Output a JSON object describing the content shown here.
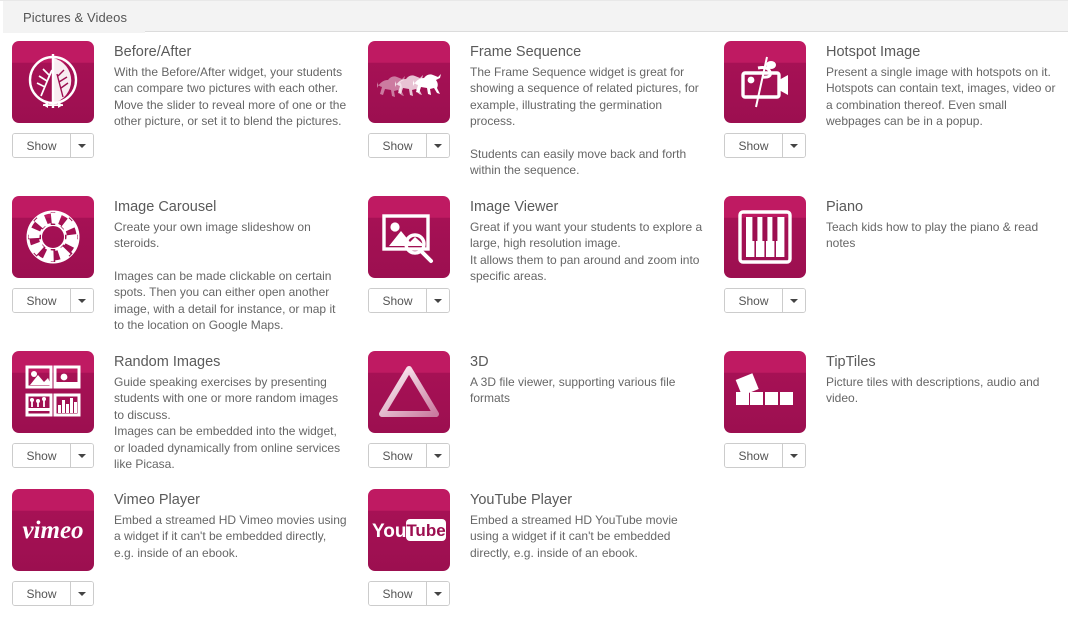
{
  "header": {
    "tab_label": "Pictures & Videos"
  },
  "button": {
    "show_label": "Show",
    "dropdown_icon": "chevron-down-icon"
  },
  "colors": {
    "tile_top": "#bf1a62",
    "tile_bottom": "#9c0f50",
    "tile_glyph": "#ffffff",
    "header_bg": "#f3f3f3",
    "title_text": "#5a5a5a",
    "body_text": "#666666",
    "button_border": "#cccccc"
  },
  "widgets": [
    {
      "title": "Before/After",
      "icon": "before-after-tree-circle-icon",
      "paragraphs": [
        "With the Before/After widget, your students can compare two pictures with each other. Move the slider to reveal more of one or the other picture, or set it to blend the pictures."
      ]
    },
    {
      "title": "Frame Sequence",
      "icon": "frame-sequence-horses-icon",
      "paragraphs": [
        "The Frame Sequence widget is great for showing a sequence of related pictures, for example, illustrating the germination process.",
        "Students can easily move back and forth within the sequence."
      ]
    },
    {
      "title": "Hotspot Image",
      "icon": "hotspot-image-camera-icon",
      "paragraphs": [
        "Present a single image with hotspots on it. Hotspots can contain text, images, video or a combination thereof. Even small webpages can be in a popup."
      ]
    },
    {
      "title": "Image Carousel",
      "icon": "image-carousel-ring-icon",
      "paragraphs": [
        "Create your own image slideshow on steroids.",
        "Images can be made clickable on certain spots. Then you can either open another image, with a detail for instance, or map it to the location on Google Maps."
      ]
    },
    {
      "title": "Image Viewer",
      "icon": "image-viewer-magnifier-icon",
      "paragraphs": [
        "Great if you want your students to explore a large, high resolution image.\nIt allows them to pan around and zoom into specific areas."
      ]
    },
    {
      "title": "Piano",
      "icon": "piano-keys-icon",
      "paragraphs": [
        "Teach kids how to play the piano & read notes"
      ]
    },
    {
      "title": "Random Images",
      "icon": "random-images-grid-icon",
      "paragraphs": [
        "Guide speaking exercises by presenting students with one or more random images to discuss.\nImages can be embedded into the widget, or loaded dynamically from online services like Picasa."
      ]
    },
    {
      "title": "3D",
      "icon": "3d-triangle-icon",
      "paragraphs": [
        "A 3D file viewer, supporting various file formats"
      ]
    },
    {
      "title": "TipTiles",
      "icon": "tiptiles-tiles-icon",
      "paragraphs": [
        "Picture tiles with descriptions, audio and video."
      ]
    },
    {
      "title": "Vimeo Player",
      "icon": "vimeo-logo-icon",
      "paragraphs": [
        "Embed a streamed HD Vimeo movies using a widget if it can't be embedded directly, e.g. inside of an ebook."
      ]
    },
    {
      "title": "YouTube Player",
      "icon": "youtube-logo-icon",
      "paragraphs": [
        "Embed a streamed HD YouTube movie using a widget if it can't be embedded directly, e.g. inside of an ebook."
      ]
    }
  ]
}
